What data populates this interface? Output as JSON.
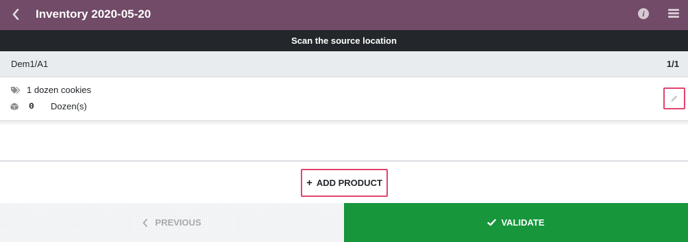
{
  "header": {
    "title": "Inventory 2020-05-20",
    "back_icon": "chevron-left-icon",
    "info_icon": "info-icon",
    "info_glyph": "i",
    "menu_icon": "hamburger-menu-icon"
  },
  "scan_banner": {
    "text": "Scan the source location"
  },
  "location": {
    "name": "Dem1/A1",
    "page_count": "1/1"
  },
  "product_line": {
    "name": "1 dozen cookies",
    "quantity": "0",
    "uom": "Dozen(s)",
    "name_icon": "tags-icon",
    "quantity_icon": "cube-icon",
    "edit_icon": "pencil-icon"
  },
  "actions": {
    "add_product_label": "ADD PRODUCT",
    "add_product_glyph": "+",
    "previous_label": "PREVIOUS",
    "validate_label": "VALIDATE"
  },
  "colors": {
    "header": "#714b67",
    "scan_banner": "#23272b",
    "highlight_border": "#e0436b",
    "validate": "#17963c"
  }
}
